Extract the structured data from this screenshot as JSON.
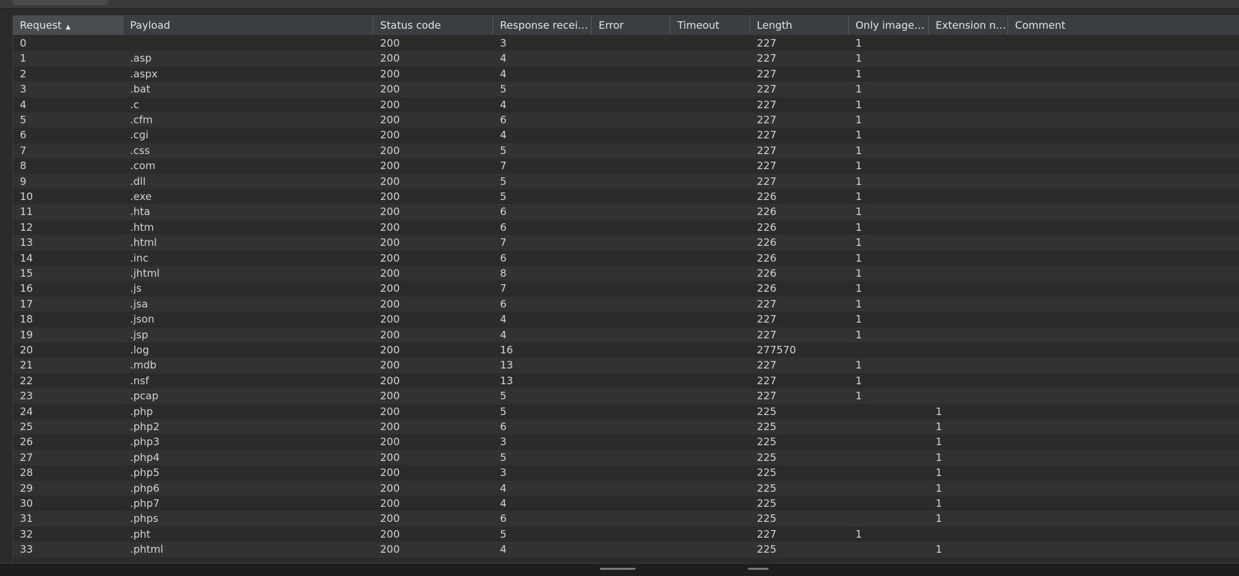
{
  "columns": [
    {
      "label": "Request",
      "sorted": true
    },
    {
      "label": "Payload"
    },
    {
      "label": "Status code"
    },
    {
      "label": "Response received"
    },
    {
      "label": "Error"
    },
    {
      "label": "Timeout"
    },
    {
      "label": "Length"
    },
    {
      "label": "Only images ar..."
    },
    {
      "label": "Extension not al..."
    },
    {
      "label": "Comment"
    }
  ],
  "sort_indicator": "^",
  "rows": [
    [
      "0",
      "",
      "200",
      "3",
      "",
      "",
      "227",
      "1",
      "",
      ""
    ],
    [
      "1",
      ".asp",
      "200",
      "4",
      "",
      "",
      "227",
      "1",
      "",
      ""
    ],
    [
      "2",
      ".aspx",
      "200",
      "4",
      "",
      "",
      "227",
      "1",
      "",
      ""
    ],
    [
      "3",
      ".bat",
      "200",
      "5",
      "",
      "",
      "227",
      "1",
      "",
      ""
    ],
    [
      "4",
      ".c",
      "200",
      "4",
      "",
      "",
      "227",
      "1",
      "",
      ""
    ],
    [
      "5",
      ".cfm",
      "200",
      "6",
      "",
      "",
      "227",
      "1",
      "",
      ""
    ],
    [
      "6",
      ".cgi",
      "200",
      "4",
      "",
      "",
      "227",
      "1",
      "",
      ""
    ],
    [
      "7",
      ".css",
      "200",
      "5",
      "",
      "",
      "227",
      "1",
      "",
      ""
    ],
    [
      "8",
      ".com",
      "200",
      "7",
      "",
      "",
      "227",
      "1",
      "",
      ""
    ],
    [
      "9",
      ".dll",
      "200",
      "5",
      "",
      "",
      "227",
      "1",
      "",
      ""
    ],
    [
      "10",
      ".exe",
      "200",
      "5",
      "",
      "",
      "226",
      "1",
      "",
      ""
    ],
    [
      "11",
      ".hta",
      "200",
      "6",
      "",
      "",
      "226",
      "1",
      "",
      ""
    ],
    [
      "12",
      ".htm",
      "200",
      "6",
      "",
      "",
      "226",
      "1",
      "",
      ""
    ],
    [
      "13",
      ".html",
      "200",
      "7",
      "",
      "",
      "226",
      "1",
      "",
      ""
    ],
    [
      "14",
      ".inc",
      "200",
      "6",
      "",
      "",
      "226",
      "1",
      "",
      ""
    ],
    [
      "15",
      ".jhtml",
      "200",
      "8",
      "",
      "",
      "226",
      "1",
      "",
      ""
    ],
    [
      "16",
      ".js",
      "200",
      "7",
      "",
      "",
      "226",
      "1",
      "",
      ""
    ],
    [
      "17",
      ".jsa",
      "200",
      "6",
      "",
      "",
      "227",
      "1",
      "",
      ""
    ],
    [
      "18",
      ".json",
      "200",
      "4",
      "",
      "",
      "227",
      "1",
      "",
      ""
    ],
    [
      "19",
      ".jsp",
      "200",
      "4",
      "",
      "",
      "227",
      "1",
      "",
      ""
    ],
    [
      "20",
      ".log",
      "200",
      "16",
      "",
      "",
      "277570",
      "",
      "",
      ""
    ],
    [
      "21",
      ".mdb",
      "200",
      "13",
      "",
      "",
      "227",
      "1",
      "",
      ""
    ],
    [
      "22",
      ".nsf",
      "200",
      "13",
      "",
      "",
      "227",
      "1",
      "",
      ""
    ],
    [
      "23",
      ".pcap",
      "200",
      "5",
      "",
      "",
      "227",
      "1",
      "",
      ""
    ],
    [
      "24",
      ".php",
      "200",
      "5",
      "",
      "",
      "225",
      "",
      "1",
      ""
    ],
    [
      "25",
      ".php2",
      "200",
      "6",
      "",
      "",
      "225",
      "",
      "1",
      ""
    ],
    [
      "26",
      ".php3",
      "200",
      "3",
      "",
      "",
      "225",
      "",
      "1",
      ""
    ],
    [
      "27",
      ".php4",
      "200",
      "5",
      "",
      "",
      "225",
      "",
      "1",
      ""
    ],
    [
      "28",
      ".php5",
      "200",
      "3",
      "",
      "",
      "225",
      "",
      "1",
      ""
    ],
    [
      "29",
      ".php6",
      "200",
      "4",
      "",
      "",
      "225",
      "",
      "1",
      ""
    ],
    [
      "30",
      ".php7",
      "200",
      "4",
      "",
      "",
      "225",
      "",
      "1",
      ""
    ],
    [
      "31",
      ".phps",
      "200",
      "6",
      "",
      "",
      "225",
      "",
      "1",
      ""
    ],
    [
      "32",
      ".pht",
      "200",
      "5",
      "",
      "",
      "227",
      "1",
      "",
      ""
    ],
    [
      "33",
      ".phtml",
      "200",
      "4",
      "",
      "",
      "225",
      "",
      "1",
      ""
    ]
  ]
}
